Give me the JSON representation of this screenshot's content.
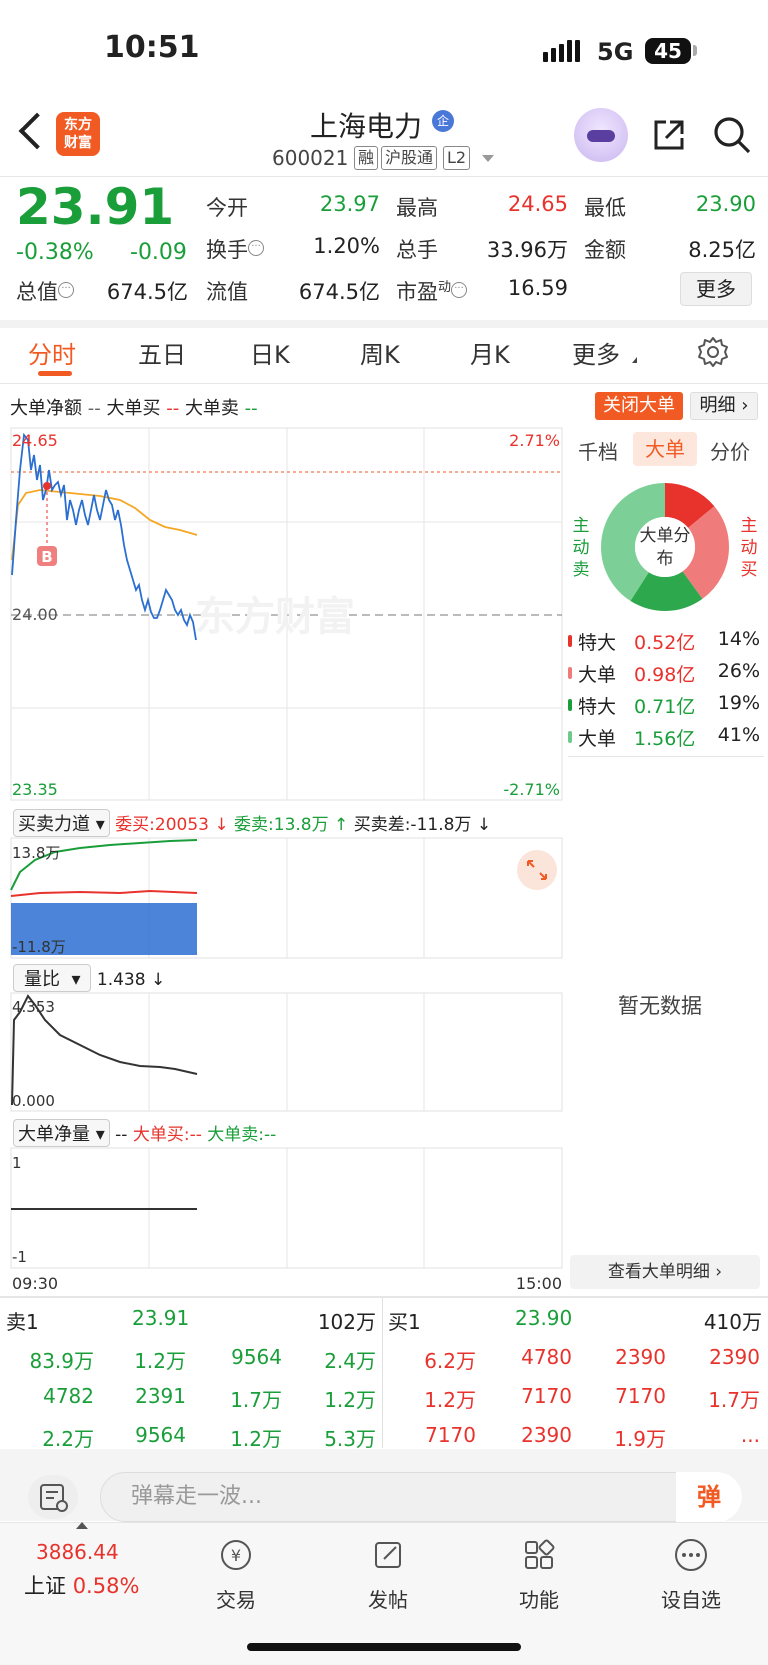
{
  "status_bar": {
    "time": "10:51",
    "network": "5G",
    "battery": "45"
  },
  "header": {
    "logo_text": "东方财富",
    "stock_name": "上海电力",
    "name_badge": "企",
    "stock_code": "600021",
    "tags": [
      "融",
      "沪股通",
      "L2"
    ]
  },
  "quote": {
    "price": "23.91",
    "change_pct": "-0.38%",
    "change_val": "-0.09",
    "fields": [
      {
        "label": "今开",
        "value": "23.97",
        "color": "green"
      },
      {
        "label": "最高",
        "value": "24.65",
        "color": "red"
      },
      {
        "label": "最低",
        "value": "23.90",
        "color": "green"
      },
      {
        "label": "换手",
        "value": "1.20%",
        "color": "black"
      },
      {
        "label": "总手",
        "value": "33.96万",
        "color": "black"
      },
      {
        "label": "金额",
        "value": "8.25亿",
        "color": "black"
      },
      {
        "label": "总值",
        "value": "674.5亿",
        "color": "black"
      },
      {
        "label": "流值",
        "value": "674.5亿",
        "color": "black"
      },
      {
        "label": "市盈",
        "value": "16.59",
        "color": "black"
      }
    ],
    "pe_superscript": "动",
    "more_label": "更多"
  },
  "tabs": [
    "分时",
    "五日",
    "日K",
    "周K",
    "月K",
    "更多"
  ],
  "big_order_bar": {
    "net_label": "大单净额",
    "net_value": "--",
    "buy_label": "大单买",
    "buy_value": "--",
    "sell_label": "大单卖",
    "sell_value": "--",
    "close_btn": "关闭大单",
    "detail_btn": "明细"
  },
  "main_chart": {
    "y_high": "24.65",
    "y_mid": "24.00",
    "y_low": "23.35",
    "pct_high": "2.71%",
    "pct_low": "-2.71%",
    "buy_marker": "B",
    "watermark": "东方财富",
    "time_start": "09:30",
    "time_end": "15:00"
  },
  "force_panel": {
    "selector": "买卖力道",
    "bid_label": "委买:20053",
    "ask_label": "委卖:13.8万",
    "diff_label": "买卖差:-11.8万",
    "y_top": "13.8万",
    "y_bottom": "-11.8万"
  },
  "ratio_panel": {
    "selector": "量比",
    "value": "1.438",
    "y_top": "4.353",
    "y_bottom": "0.000"
  },
  "net_panel": {
    "selector": "大单净量",
    "value": "--",
    "buy": "大单买:--",
    "sell": "大单卖:--",
    "y_top": "1",
    "y_bottom": "-1"
  },
  "right_panel": {
    "tabs": [
      "千档",
      "大单",
      "分价"
    ],
    "left_side": "主动卖",
    "right_side": "主动买",
    "donut_center": "大单分布",
    "flows": [
      {
        "type": "特大",
        "amount": "0.52亿",
        "pct": "14%",
        "color": "#e8322c"
      },
      {
        "type": "大单",
        "amount": "0.98亿",
        "pct": "26%",
        "color": "#f07b7b"
      },
      {
        "type": "特大",
        "amount": "0.71亿",
        "pct": "19%",
        "color": "#1a9e3a"
      },
      {
        "type": "大单",
        "amount": "1.56亿",
        "pct": "41%",
        "color": "#6fc98a"
      }
    ],
    "no_data": "暂无数据",
    "view_detail": "查看大单明细"
  },
  "order_book": {
    "sell1_label": "卖1",
    "sell1_price": "23.91",
    "sell1_vol": "102万",
    "buy1_label": "买1",
    "buy1_price": "23.90",
    "buy1_vol": "410万",
    "sell_rows": [
      [
        "83.9万",
        "1.2万",
        "9564",
        "2.4万"
      ],
      [
        "4782",
        "2391",
        "1.7万",
        "1.2万"
      ],
      [
        "2.2万",
        "9564",
        "1.2万",
        "5.3万"
      ]
    ],
    "buy_rows": [
      [
        "6.2万",
        "4780",
        "2390",
        "2390"
      ],
      [
        "1.2万",
        "7170",
        "7170",
        "1.7万"
      ],
      [
        "7170",
        "2390",
        "1.9万",
        "..."
      ]
    ]
  },
  "danmaku": {
    "placeholder": "弹幕走一波...",
    "button": "弹"
  },
  "bottom_nav": {
    "index_value": "3886.44",
    "index_name": "上证",
    "index_pct": "0.58%",
    "items": [
      "交易",
      "发帖",
      "功能",
      "设自选"
    ]
  }
}
